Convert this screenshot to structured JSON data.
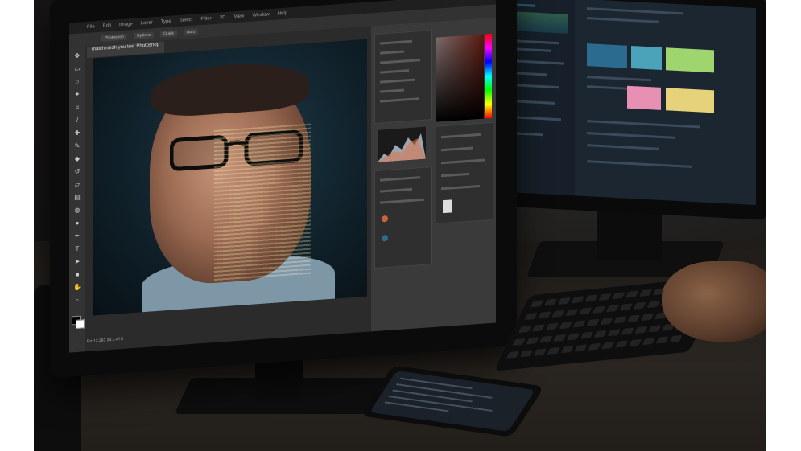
{
  "photo": {
    "description_tags": [
      "left-monitor",
      "right-monitor",
      "keyboard",
      "hand",
      "smartphone",
      "desk"
    ],
    "left_screen": {
      "menu_items": [
        "File",
        "Edit",
        "Image",
        "Layer",
        "Type",
        "Select",
        "Filter",
        "3D",
        "View",
        "Window",
        "Help"
      ],
      "options": [
        "Photoshop",
        "Options",
        "Quick",
        "Auto"
      ],
      "document_tab": "matchmesh you test Photoshop",
      "status_text": "ErrI12.283 33.3 ATS"
    }
  },
  "colors": {
    "scene_bg": "#161514",
    "screen_left": "#2b2b2b",
    "screen_right": "#1c2631",
    "accent_blue": "#2a6b8f",
    "accent_teal": "#4aa3b8",
    "accent_green": "#9fd56f",
    "accent_pink": "#e88fb4",
    "accent_yellow": "#e5d27a"
  }
}
